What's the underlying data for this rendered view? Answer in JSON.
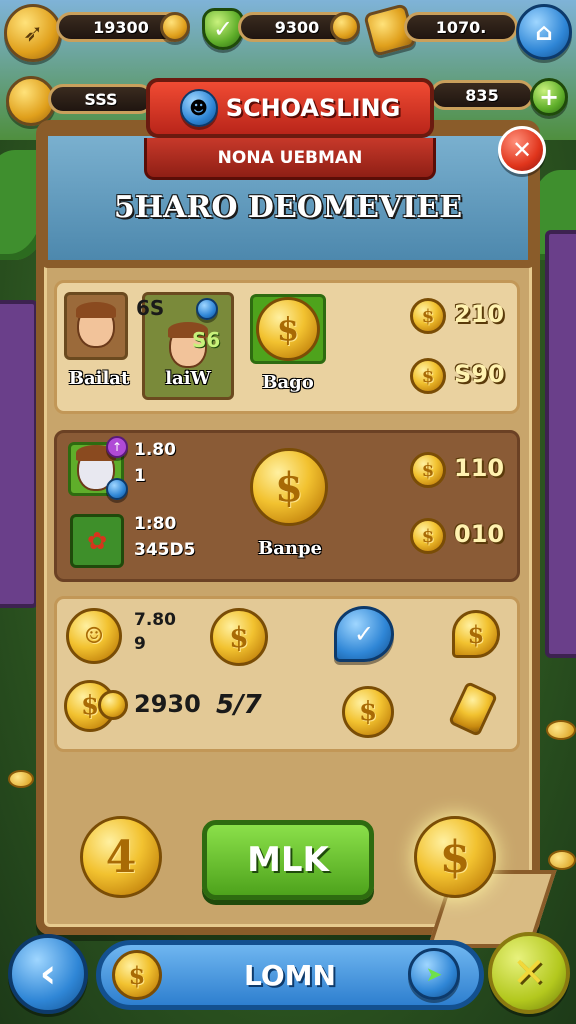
{
  "colors": {
    "accent_red": "#e0351c",
    "accent_green": "#5fae2a",
    "accent_blue": "#2f86d6",
    "gold": "#f2c230",
    "wood": "#8a5c2a"
  },
  "top_bar": {
    "resource1": {
      "value": "19300",
      "icon": "arrow-icon"
    },
    "resource2": {
      "value": "9300",
      "icon": "shield-icon"
    },
    "resource3": {
      "value": "1070.",
      "icon": "gold-bar-icon"
    },
    "resource4": {
      "value": "SSS",
      "icon": "barrel-icon"
    },
    "resource5": {
      "value": "835",
      "icon": "plus-icon"
    },
    "home_icon": "home-icon"
  },
  "header": {
    "title": "SCHOASLING",
    "subtitle": "NONA UEBMAN",
    "heading": "5HARO DEOMEVIEE",
    "close_icon": "close-icon"
  },
  "section1": {
    "card1_label": "Bailat",
    "card2_top_value": "6S",
    "card2_badge_value": "S6",
    "card2_label": "laiW",
    "coin_label": "Bago",
    "price1": "210",
    "price2": "S90"
  },
  "section2": {
    "row1_value_a": "1.80",
    "row1_value_b": "1",
    "row2_value_a": "1:80",
    "row2_value_b": "345D5",
    "coin_label": "Banpe",
    "price1": "110",
    "price2": "010"
  },
  "section3": {
    "row1_value_a": "7.80",
    "row1_value_b": "9",
    "row2_value": "2930",
    "row2_side_value": "5/7"
  },
  "actions": {
    "left_coin_value": "4",
    "main_button": "MLK"
  },
  "bottom": {
    "bar_label": "LOMN",
    "back_icon": "back-arrow-icon",
    "confirm_icon": "cross-icon"
  }
}
